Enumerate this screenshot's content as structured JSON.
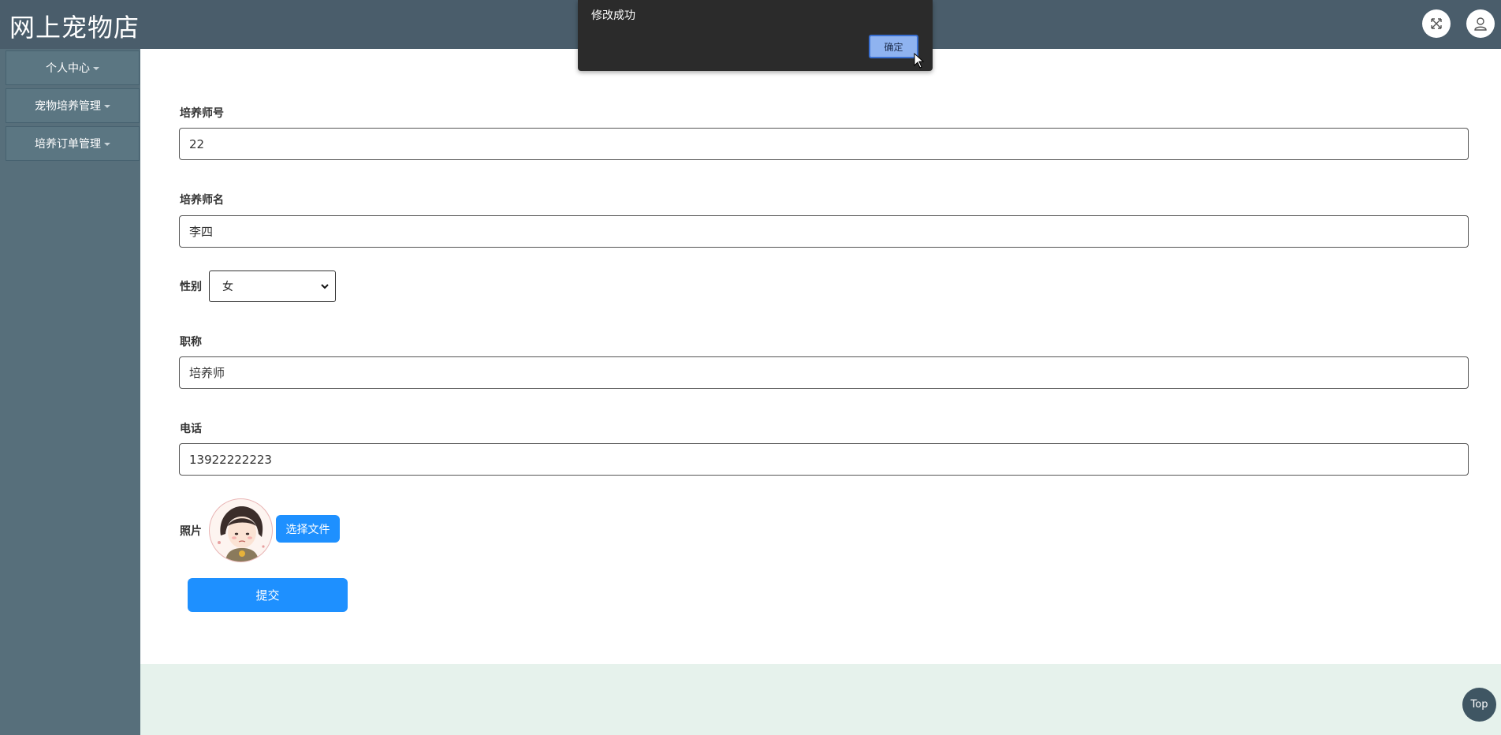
{
  "app": {
    "title": "网上宠物店"
  },
  "header": {
    "fullscreen_icon": "expand-arrows-icon",
    "user_icon": "user-icon"
  },
  "sidebar": {
    "items": [
      {
        "label": "个人中心"
      },
      {
        "label": "宠物培养管理"
      },
      {
        "label": "培养订单管理"
      }
    ]
  },
  "form": {
    "trainer_no": {
      "label": "培养师号",
      "value": "22"
    },
    "trainer_name": {
      "label": "培养师名",
      "value": "李四"
    },
    "gender": {
      "label": "性别",
      "selected": "女"
    },
    "title": {
      "label": "职称",
      "value": "培养师"
    },
    "phone": {
      "label": "电话",
      "value": "13922222223"
    },
    "photo": {
      "label": "照片",
      "button": "选择文件"
    },
    "submit": "提交"
  },
  "dialog": {
    "message": "修改成功",
    "ok": "确定"
  },
  "footer": {
    "top_label": "Top"
  },
  "colors": {
    "topbar": "#4a5d6b",
    "sidebar": "#576f7b",
    "accent": "#1e90ff",
    "footer_bg": "#e6f2ec"
  }
}
